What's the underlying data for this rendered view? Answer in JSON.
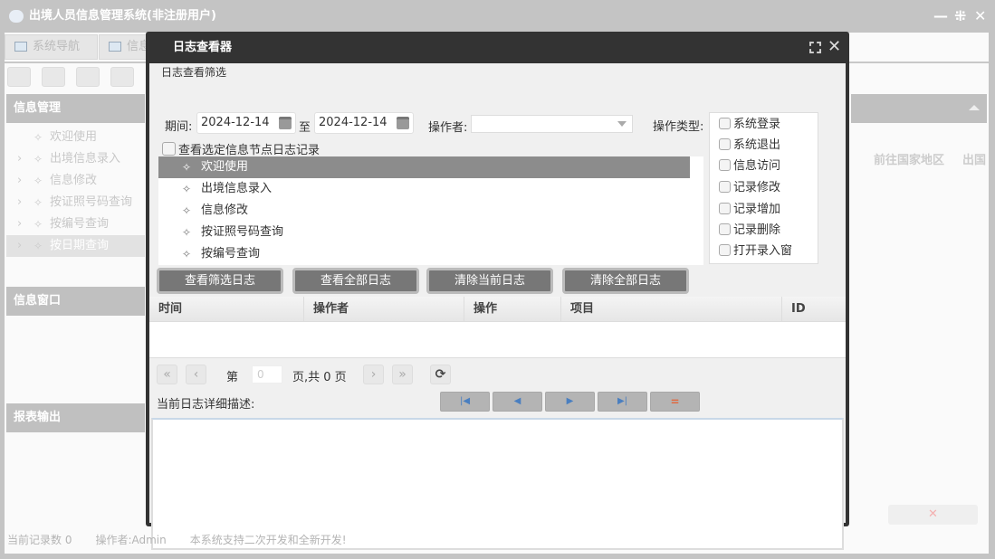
{
  "app": {
    "title": "出境人员信息管理系统(非注册用户)",
    "logo": "yf",
    "controls": {
      "minimize": "—",
      "restore": "⇲",
      "close": "✕"
    }
  },
  "tabs": [
    {
      "label": "系统导航"
    },
    {
      "label": "信息"
    }
  ],
  "sidebar": {
    "sections": [
      "信息管理",
      "信息窗口",
      "报表输出"
    ],
    "tree": [
      {
        "label": "欢迎使用"
      },
      {
        "label": "出境信息录入"
      },
      {
        "label": "信息修改"
      },
      {
        "label": "按证照号码查询"
      },
      {
        "label": "按编号查询"
      },
      {
        "label": "按日期查询",
        "selected": true
      }
    ]
  },
  "right_panel": {
    "columns": [
      "前往国家地区",
      "出国"
    ]
  },
  "status": {
    "record_count": "当前记录数 0",
    "operator": "操作者:Admin",
    "note": "本系统支持二次开发和全新开发!"
  },
  "dialog": {
    "title": "日志查看器",
    "filter": {
      "group_label": "日志查看筛选",
      "period_label": "期间:",
      "date_from": "2024-12-14",
      "to_label": "至",
      "date_to": "2024-12-14",
      "operator_label": "操作者:",
      "operator_value": "",
      "type_label": "操作类型:",
      "node_checkbox_label": "查看选定信息节点日志记录",
      "nodes": [
        {
          "label": "欢迎使用",
          "selected": true
        },
        {
          "label": "出境信息录入"
        },
        {
          "label": "信息修改"
        },
        {
          "label": "按证照号码查询"
        },
        {
          "label": "按编号查询"
        }
      ],
      "types": [
        "系统登录",
        "系统退出",
        "信息访问",
        "记录修改",
        "记录增加",
        "记录删除",
        "打开录入窗"
      ]
    },
    "buttons": [
      "查看筛选日志",
      "查看全部日志",
      "清除当前日志",
      "清除全部日志"
    ],
    "grid": {
      "columns": [
        "时间",
        "操作者",
        "操作",
        "项目",
        "ID"
      ],
      "rows": []
    },
    "pager": {
      "page_label": "第",
      "page_value": "0",
      "total_label": "页,共 0 页"
    },
    "detail_label": "当前日志详细描述:",
    "detail_value": "",
    "nav_icons": [
      "first-icon",
      "prev-icon",
      "next-icon",
      "last-icon",
      "minus-icon"
    ]
  },
  "colors": {
    "dialog_titlebar": "#333333",
    "selected_row": "#8c8c8c",
    "button": "#777777"
  }
}
